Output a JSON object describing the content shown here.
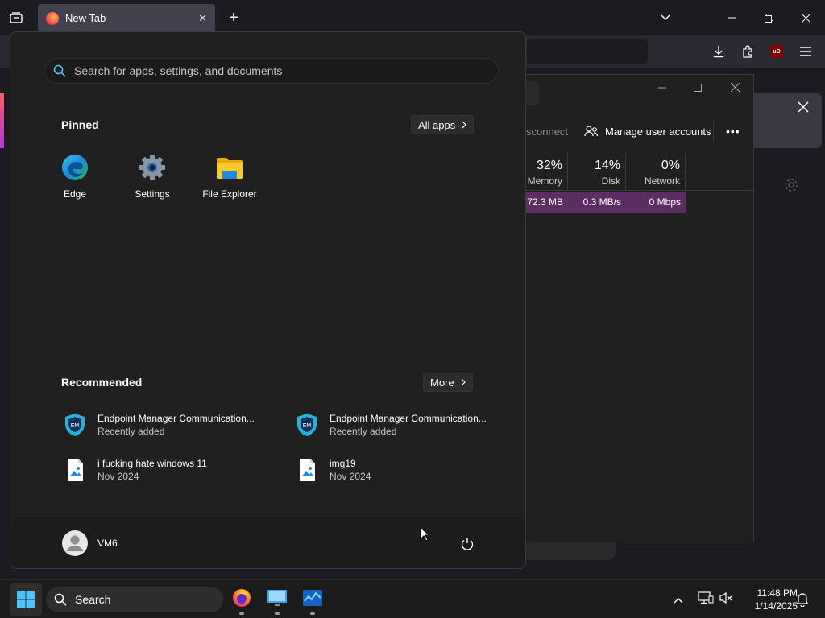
{
  "browser": {
    "tab_title": "New Tab",
    "close_tab": "✕",
    "new_tab": "+",
    "ext_badge": "uD"
  },
  "taskmgr": {
    "cmd_partial": "sconnect",
    "manage_users": "Manage user accounts",
    "more": "•••",
    "columns": [
      {
        "pct": "32%",
        "label": "Memory"
      },
      {
        "pct": "14%",
        "label": "Disk"
      },
      {
        "pct": "0%",
        "label": "Network"
      }
    ],
    "row": {
      "memory": "72.3 MB",
      "disk": "0.3 MB/s",
      "network": "0 Mbps"
    }
  },
  "start": {
    "search_placeholder": "Search for apps, settings, and documents",
    "pinned_title": "Pinned",
    "all_apps_label": "All apps",
    "pinned": [
      {
        "label": "Edge",
        "icon": "edge-icon"
      },
      {
        "label": "Settings",
        "icon": "settings-gear-icon"
      },
      {
        "label": "File Explorer",
        "icon": "folder-icon"
      }
    ],
    "recommended_title": "Recommended",
    "more_label": "More",
    "recommended": [
      {
        "title": "Endpoint Manager Communication...",
        "sub": "Recently added",
        "icon": "endpoint-manager-icon"
      },
      {
        "title": "Endpoint Manager Communication...",
        "sub": "Recently added",
        "icon": "endpoint-manager-icon"
      },
      {
        "title": "i fucking hate windows 11",
        "sub": "Nov 2024",
        "icon": "image-file-icon"
      },
      {
        "title": "img19",
        "sub": "Nov 2024",
        "icon": "image-file-icon"
      }
    ],
    "user_name": "VM6"
  },
  "taskbar": {
    "search_label": "Search",
    "time": "11:48 PM",
    "date": "1/14/2025"
  },
  "colors": {
    "accent_blue": "#0078d4",
    "taskmgr_highlight": "#5c2d63",
    "ublock_red": "#800000"
  }
}
